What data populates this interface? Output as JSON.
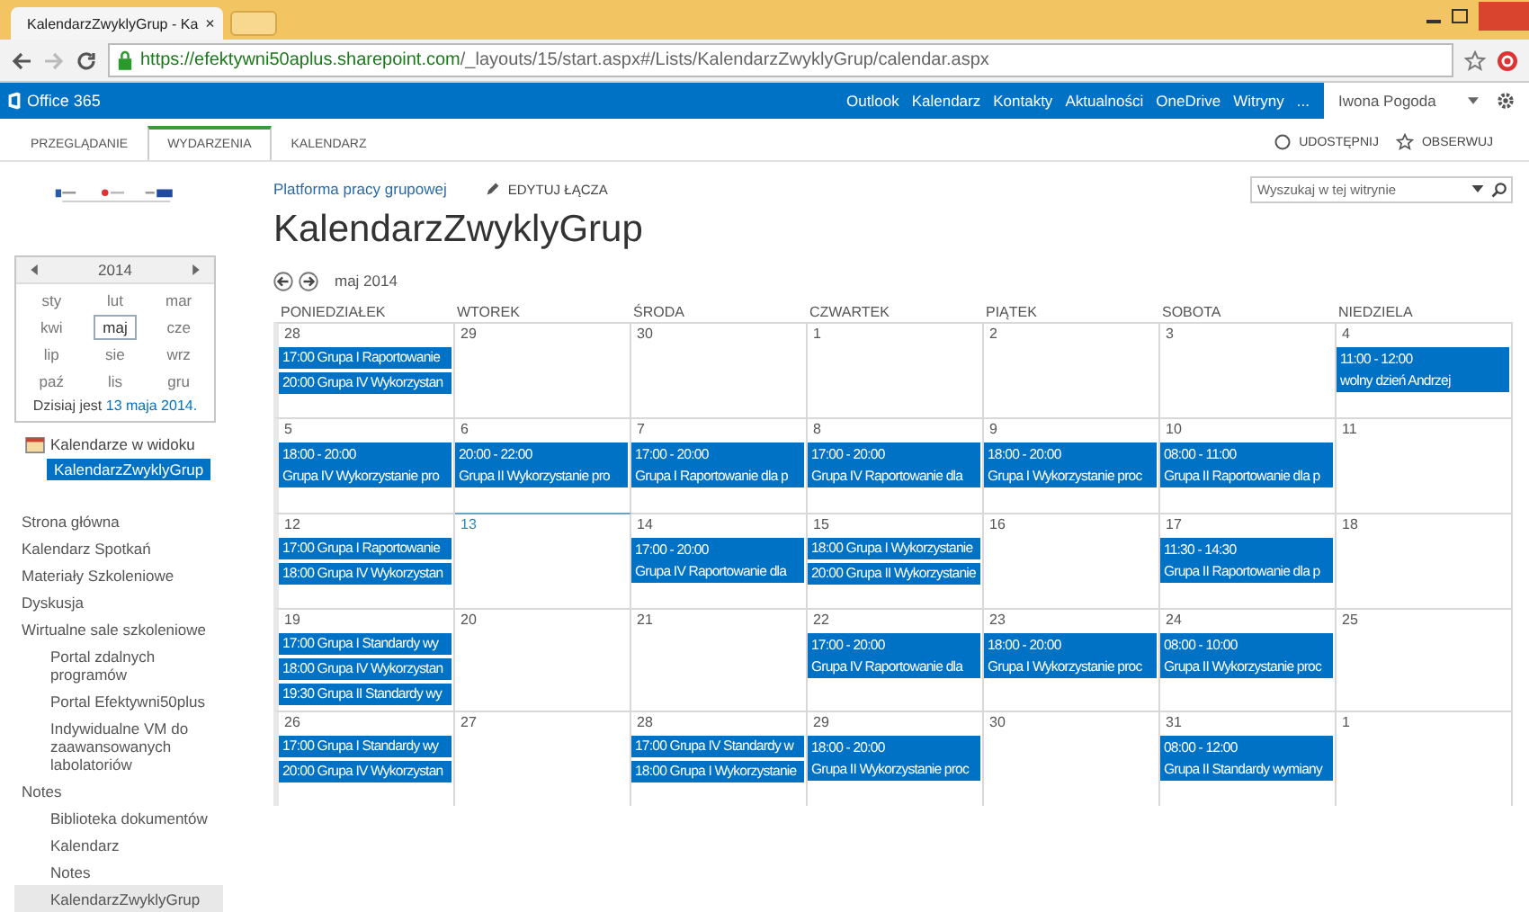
{
  "browser": {
    "tab_title": "KalendarzZwyklyGrup - Ka",
    "tab_close": "×",
    "url_host": "https://efektywni50aplus.sharepoint.com",
    "url_path": "/_layouts/15/start.aspx#/Lists/KalendarzZwyklyGrup/calendar.aspx"
  },
  "suite_bar": {
    "brand": "Office 365",
    "links": [
      "Outlook",
      "Kalendarz",
      "Kontakty",
      "Aktualności",
      "OneDrive",
      "Witryny"
    ],
    "more": "...",
    "user": "Iwona Pogoda"
  },
  "ribbon": {
    "tabs": [
      {
        "label": "PRZEGLĄDANIE",
        "selected": false
      },
      {
        "label": "WYDARZENIA",
        "selected": true
      },
      {
        "label": "KALENDARZ",
        "selected": false
      }
    ],
    "share": "UDOSTĘPNIJ",
    "follow": "OBSERWUJ"
  },
  "date_picker": {
    "year": "2014",
    "months": [
      {
        "label": "sty",
        "selected": false
      },
      {
        "label": "lut",
        "selected": false
      },
      {
        "label": "mar",
        "selected": false
      },
      {
        "label": "kwi",
        "selected": false
      },
      {
        "label": "maj",
        "selected": true
      },
      {
        "label": "cze",
        "selected": false
      },
      {
        "label": "lip",
        "selected": false
      },
      {
        "label": "sie",
        "selected": false
      },
      {
        "label": "wrz",
        "selected": false
      },
      {
        "label": "paź",
        "selected": false
      },
      {
        "label": "lis",
        "selected": false
      },
      {
        "label": "gru",
        "selected": false
      }
    ],
    "today_prefix": "Dzisiaj jest",
    "today_link": "13 maja 2014."
  },
  "calendars_in_view": {
    "title": "Kalendarze w widoku",
    "items": [
      "KalendarzZwyklyGrup"
    ]
  },
  "nav": [
    {
      "label": "Strona główna",
      "selected": false
    },
    {
      "label": "Kalendarz Spotkań",
      "selected": false
    },
    {
      "label": "Materiały Szkoleniowe",
      "selected": false
    },
    {
      "label": "Dyskusja",
      "selected": false
    },
    {
      "label": "Wirtualne sale szkoleniowe",
      "selected": false,
      "children": [
        {
          "label": "Portal zdalnych programów",
          "selected": false
        },
        {
          "label": "Portal Efektywni50plus",
          "selected": false
        },
        {
          "label": "Indywidualne VM do zaawansowanych labolatoriów",
          "selected": false
        }
      ]
    },
    {
      "label": "Notes",
      "selected": false,
      "children": [
        {
          "label": "Biblioteka dokumentów",
          "selected": false
        },
        {
          "label": "Kalendarz",
          "selected": false
        },
        {
          "label": "Notes",
          "selected": false
        },
        {
          "label": "KalendarzZwyklyGrup",
          "selected": true
        }
      ]
    }
  ],
  "breadcrumb": {
    "site_link": "Platforma pracy grupowej",
    "edit_links": "EDYTUJ ŁĄCZA"
  },
  "search": {
    "placeholder": "Wyszukaj w tej witrynie"
  },
  "page_title": "KalendarzZwyklyGrup",
  "calendar": {
    "month_label": "maj 2014",
    "weekdays": [
      "PONIEDZIAŁEK",
      "WTOREK",
      "ŚRODA",
      "CZWARTEK",
      "PIĄTEK",
      "SOBOTA",
      "NIEDZIELA"
    ],
    "weeks": [
      {
        "days": [
          {
            "day": "28",
            "today": false,
            "events": [
              {
                "kind": "short",
                "text": "17:00 Grupa I Raportowanie"
              },
              {
                "kind": "short",
                "text": "20:00 Grupa IV Wykorzystan"
              }
            ]
          },
          {
            "day": "29",
            "today": false
          },
          {
            "day": "30",
            "today": false
          },
          {
            "day": "1",
            "today": false
          },
          {
            "day": "2",
            "today": false
          },
          {
            "day": "3",
            "today": false
          },
          {
            "day": "4",
            "today": false,
            "events": [
              {
                "kind": "block",
                "time": "11:00 - 12:00",
                "title": "wolny dzień Andrzej"
              }
            ]
          }
        ]
      },
      {
        "days": [
          {
            "day": "5",
            "today": false,
            "events": [
              {
                "kind": "block",
                "time": "18:00 - 20:00",
                "title": "Grupa IV Wykorzystanie pro"
              }
            ]
          },
          {
            "day": "6",
            "today": false,
            "events": [
              {
                "kind": "block",
                "time": "20:00 - 22:00",
                "title": "Grupa II Wykorzystanie pro"
              }
            ]
          },
          {
            "day": "7",
            "today": false,
            "events": [
              {
                "kind": "block",
                "time": "17:00 - 20:00",
                "title": "Grupa I Raportowanie dla p"
              }
            ]
          },
          {
            "day": "8",
            "today": false,
            "events": [
              {
                "kind": "block",
                "time": "17:00 - 20:00",
                "title": "Grupa IV Raportowanie dla"
              }
            ]
          },
          {
            "day": "9",
            "today": false,
            "events": [
              {
                "kind": "block",
                "time": "18:00 - 20:00",
                "title": "Grupa I Wykorzystanie proc"
              }
            ]
          },
          {
            "day": "10",
            "today": false,
            "events": [
              {
                "kind": "block",
                "time": "08:00 - 11:00",
                "title": "Grupa II Raportowanie dla p"
              }
            ]
          },
          {
            "day": "11",
            "today": false
          }
        ]
      },
      {
        "days": [
          {
            "day": "12",
            "today": false,
            "events": [
              {
                "kind": "short",
                "text": "17:00 Grupa I Raportowanie"
              },
              {
                "kind": "short",
                "text": "18:00 Grupa IV Wykorzystan"
              }
            ]
          },
          {
            "day": "13",
            "today": true
          },
          {
            "day": "14",
            "today": false,
            "events": [
              {
                "kind": "block",
                "time": "17:00 - 20:00",
                "title": "Grupa IV Raportowanie dla"
              }
            ]
          },
          {
            "day": "15",
            "today": false,
            "events": [
              {
                "kind": "short",
                "text": "18:00 Grupa I Wykorzystanie"
              },
              {
                "kind": "short",
                "text": "20:00 Grupa II Wykorzystanie"
              }
            ]
          },
          {
            "day": "16",
            "today": false
          },
          {
            "day": "17",
            "today": false,
            "events": [
              {
                "kind": "block",
                "time": "11:30 - 14:30",
                "title": "Grupa II Raportowanie dla p"
              }
            ]
          },
          {
            "day": "18",
            "today": false
          }
        ]
      },
      {
        "days": [
          {
            "day": "19",
            "today": false,
            "events": [
              {
                "kind": "short",
                "text": "17:00 Grupa I Standardy wy"
              },
              {
                "kind": "short",
                "text": "18:00 Grupa IV Wykorzystan"
              },
              {
                "kind": "short",
                "text": "19:30 Grupa II Standardy wy"
              }
            ]
          },
          {
            "day": "20",
            "today": false
          },
          {
            "day": "21",
            "today": false
          },
          {
            "day": "22",
            "today": false,
            "events": [
              {
                "kind": "block",
                "time": "17:00 - 20:00",
                "title": "Grupa IV Raportowanie dla"
              }
            ]
          },
          {
            "day": "23",
            "today": false,
            "events": [
              {
                "kind": "block",
                "time": "18:00 - 20:00",
                "title": "Grupa I Wykorzystanie proc"
              }
            ]
          },
          {
            "day": "24",
            "today": false,
            "events": [
              {
                "kind": "block",
                "time": "08:00 - 10:00",
                "title": "Grupa II Wykorzystanie proc"
              }
            ]
          },
          {
            "day": "25",
            "today": false
          }
        ]
      },
      {
        "days": [
          {
            "day": "26",
            "today": false,
            "events": [
              {
                "kind": "short",
                "text": "17:00 Grupa I Standardy wy"
              },
              {
                "kind": "short",
                "text": "20:00 Grupa IV Wykorzystan"
              }
            ]
          },
          {
            "day": "27",
            "today": false
          },
          {
            "day": "28",
            "today": false,
            "events": [
              {
                "kind": "short",
                "text": "17:00 Grupa IV Standardy w"
              },
              {
                "kind": "short",
                "text": "18:00 Grupa I Wykorzystanie"
              }
            ]
          },
          {
            "day": "29",
            "today": false,
            "events": [
              {
                "kind": "block",
                "time": "18:00 - 20:00",
                "title": "Grupa II Wykorzystanie proc"
              }
            ]
          },
          {
            "day": "30",
            "today": false
          },
          {
            "day": "31",
            "today": false,
            "events": [
              {
                "kind": "block",
                "time": "08:00 - 12:00",
                "title": "Grupa II Standardy wymiany"
              }
            ]
          },
          {
            "day": "1",
            "today": false
          }
        ]
      }
    ]
  }
}
